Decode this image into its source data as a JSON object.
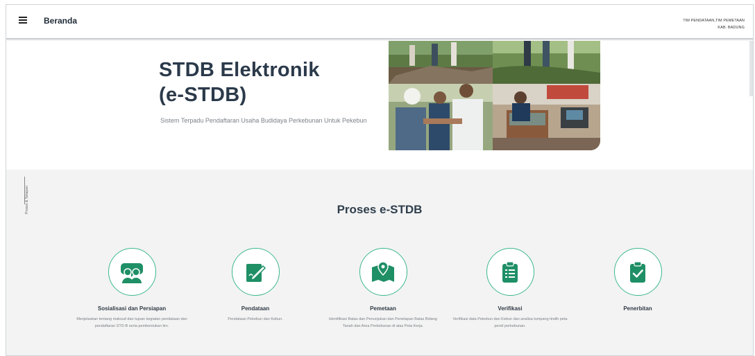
{
  "header": {
    "title": "Beranda",
    "user_line1": "TIM PENDATAAN,TIM PEMETAAN",
    "user_line2": "KAB. BADUNG"
  },
  "hero": {
    "title_line1": "STDB Elektronik",
    "title_line2": "(e-STDB)",
    "description": "Sistem Terpadu Pendaftaran Usaha Budidaya Perkebunan Untuk Pekebun"
  },
  "process": {
    "side_label": "Proses & Tahapan",
    "title": "Proses e-STDB",
    "steps": [
      {
        "label": "Sosialisasi dan Persiapan",
        "description": "Menjelaskan tentang maksud dan tujuan kegiatan pendataan dan pendaftaran STD-B serta pembentukan tim.",
        "icon": "people-discussion-icon"
      },
      {
        "label": "Pendataan",
        "description": "Pendataan Pekebun dan Kebun.",
        "icon": "edit-document-icon"
      },
      {
        "label": "Pemetaan",
        "description": "Identifikasi Batas dan Penunjukan dan Penetapan Batas Bidang Tanah dan Area Perkebunan di atas Peta Kerja.",
        "icon": "map-pin-icon"
      },
      {
        "label": "Verifikasi",
        "description": "Verifikasi data Pekebun dan Kebun dan analisa tumpang tindih peta persil perkebunan.",
        "icon": "clipboard-list-icon"
      },
      {
        "label": "Penerbitan",
        "description": "",
        "icon": "clipboard-check-icon"
      }
    ]
  },
  "colors": {
    "accent": "#3cb88a",
    "title": "#2b3a4a"
  }
}
